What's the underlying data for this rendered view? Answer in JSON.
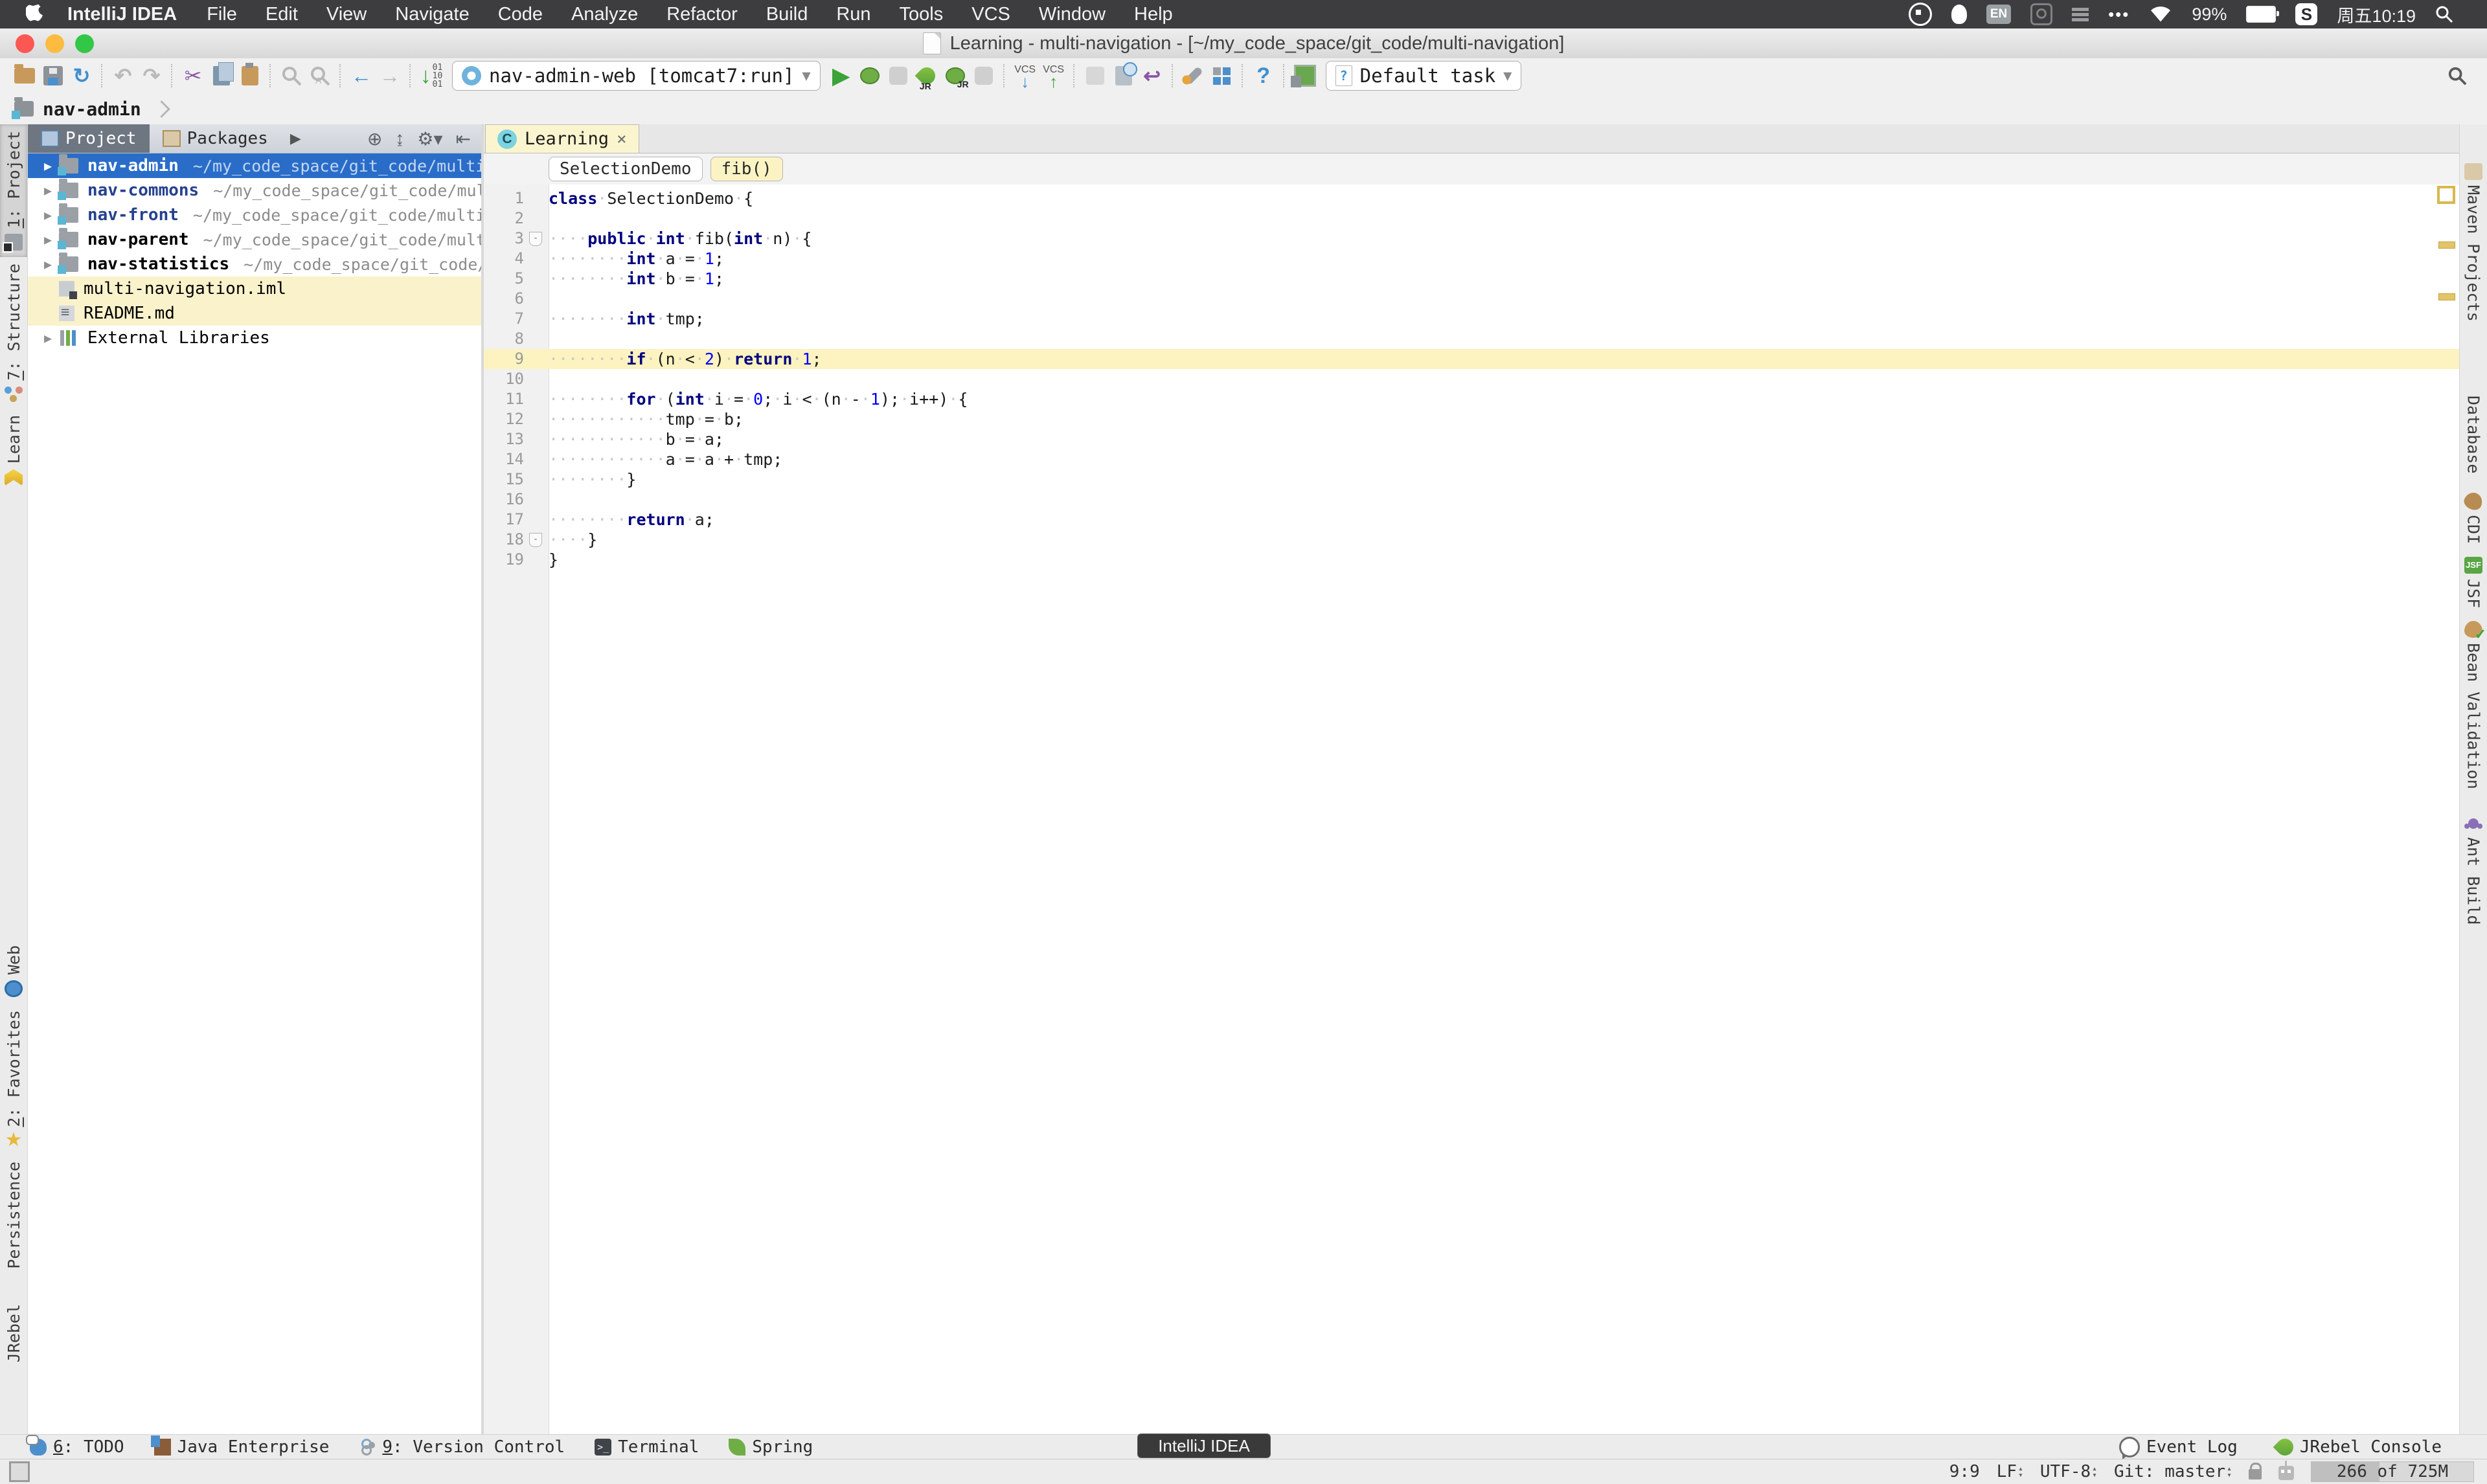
{
  "menubar": {
    "app_name": "IntelliJ IDEA",
    "items": [
      "File",
      "Edit",
      "View",
      "Navigate",
      "Code",
      "Analyze",
      "Refactor",
      "Build",
      "Run",
      "Tools",
      "VCS",
      "Window",
      "Help"
    ],
    "status": {
      "input_badge": "EN",
      "battery_pct": "99%",
      "sogou_badge": "S",
      "clock": "周五10:19",
      "icons": [
        "record-icon",
        "qq-icon",
        "input-en-badge",
        "input-search-icon",
        "bars-icon",
        "more-dots-icon",
        "wifi-icon",
        "battery-icon",
        "sogou-icon",
        "spotlight-search-icon"
      ]
    }
  },
  "titlebar": {
    "title": "Learning - multi-navigation - [~/my_code_space/git_code/multi-navigation]"
  },
  "toolbar": {
    "run_config": "nav-admin-web [tomcat7:run]",
    "task_selector": "Default task",
    "vcs_down_label": "VCS",
    "vcs_up_label": "VCS",
    "hex_bits": "01 10 01",
    "left_icon_groups": [
      [
        "open-folder-icon",
        "save-icon",
        "sync-icon"
      ],
      [
        "undo-icon",
        "redo-icon"
      ],
      [
        "cut-icon",
        "copy-icon",
        "paste-icon"
      ],
      [
        "find-icon",
        "replace-icon"
      ],
      [
        "back-icon",
        "forward-icon"
      ],
      [
        "hex-download-icon"
      ]
    ],
    "run_icons": [
      "run-icon",
      "debug-icon",
      "coverage-icon",
      "jrebel-run-icon",
      "jrebel-debug-icon",
      "profile-icon"
    ],
    "misc_icon_groups": [
      [
        "shelve-icon",
        "history-icon",
        "revert-icon"
      ],
      [
        "settings-wrench-icon",
        "project-structure-icon"
      ],
      [
        "help-icon"
      ],
      [
        "jrebel-save-icon"
      ]
    ],
    "search_icon": "toolbar-search-icon"
  },
  "breadcrumb": {
    "module": "nav-admin"
  },
  "project_panel": {
    "tabs": [
      "Project",
      "Packages"
    ],
    "header_icons": [
      "locate-icon",
      "collapse-all-icon",
      "gear-menu-icon",
      "hide-panel-icon"
    ],
    "tree": [
      {
        "type": "module",
        "name": "nav-admin",
        "path": "~/my_code_space/git_code/multi-n",
        "selected": true,
        "arrow": true
      },
      {
        "type": "module",
        "name": "nav-commons",
        "path": "~/my_code_space/git_code/multi",
        "name_color": "blue",
        "arrow": true
      },
      {
        "type": "module",
        "name": "nav-front",
        "path": "~/my_code_space/git_code/multi-n",
        "name_color": "blue",
        "arrow": true
      },
      {
        "type": "module",
        "name": "nav-parent",
        "path": "~/my_code_space/git_code/multi-",
        "arrow": true
      },
      {
        "type": "module",
        "name": "nav-statistics",
        "path": "~/my_code_space/git_code/mu",
        "arrow": true
      },
      {
        "type": "iml",
        "name": "multi-navigation.iml",
        "highlight": true,
        "plain": true
      },
      {
        "type": "md",
        "name": "README.md",
        "highlight": true,
        "plain": true
      },
      {
        "type": "lib",
        "name": "External Libraries",
        "arrow": true,
        "plain": true
      }
    ]
  },
  "editor": {
    "tab_label": "Learning",
    "tab_close": "×",
    "crumbs": [
      {
        "label": "SelectionDemo",
        "current": false
      },
      {
        "label": "fib()",
        "current": true
      }
    ],
    "lines": [
      {
        "n": 1,
        "tokens": [
          [
            "k",
            "class"
          ],
          [
            "p",
            " SelectionDemo {"
          ]
        ]
      },
      {
        "n": 2,
        "tokens": []
      },
      {
        "n": 3,
        "fold": "-",
        "tokens": [
          [
            "p",
            "    "
          ],
          [
            "k",
            "public"
          ],
          [
            "p",
            " "
          ],
          [
            "k",
            "int"
          ],
          [
            "p",
            " fib("
          ],
          [
            "k",
            "int"
          ],
          [
            "p",
            " n) {"
          ]
        ]
      },
      {
        "n": 4,
        "tokens": [
          [
            "p",
            "        "
          ],
          [
            "k",
            "int"
          ],
          [
            "p",
            " a = "
          ],
          [
            "n2",
            "1"
          ],
          [
            "p",
            ";"
          ]
        ]
      },
      {
        "n": 5,
        "tokens": [
          [
            "p",
            "        "
          ],
          [
            "k",
            "int"
          ],
          [
            "p",
            " b = "
          ],
          [
            "n2",
            "1"
          ],
          [
            "p",
            ";"
          ]
        ]
      },
      {
        "n": 6,
        "tokens": []
      },
      {
        "n": 7,
        "tokens": [
          [
            "p",
            "        "
          ],
          [
            "k",
            "int"
          ],
          [
            "p",
            " tmp;"
          ]
        ]
      },
      {
        "n": 8,
        "tokens": []
      },
      {
        "n": 9,
        "hl": true,
        "tokens": [
          [
            "p",
            "        "
          ],
          [
            "k",
            "if"
          ],
          [
            "p",
            " (n < "
          ],
          [
            "n2",
            "2"
          ],
          [
            "p",
            ") "
          ],
          [
            "k",
            "return"
          ],
          [
            "p",
            " "
          ],
          [
            "n2",
            "1"
          ],
          [
            "p",
            ";"
          ]
        ]
      },
      {
        "n": 10,
        "tokens": []
      },
      {
        "n": 11,
        "tokens": [
          [
            "p",
            "        "
          ],
          [
            "k",
            "for"
          ],
          [
            "p",
            " ("
          ],
          [
            "k",
            "int"
          ],
          [
            "p",
            " i = "
          ],
          [
            "n2",
            "0"
          ],
          [
            "p",
            "; i < (n - "
          ],
          [
            "n2",
            "1"
          ],
          [
            "p",
            "); i++) {"
          ]
        ]
      },
      {
        "n": 12,
        "tokens": [
          [
            "p",
            "            tmp = b;"
          ]
        ]
      },
      {
        "n": 13,
        "tokens": [
          [
            "p",
            "            b = a;"
          ]
        ]
      },
      {
        "n": 14,
        "tokens": [
          [
            "p",
            "            a = a + tmp;"
          ]
        ]
      },
      {
        "n": 15,
        "tokens": [
          [
            "p",
            "        }"
          ]
        ]
      },
      {
        "n": 16,
        "tokens": []
      },
      {
        "n": 17,
        "tokens": [
          [
            "p",
            "        "
          ],
          [
            "k",
            "return"
          ],
          [
            "p",
            " a;"
          ]
        ]
      },
      {
        "n": 18,
        "fold": "-",
        "tokens": [
          [
            "p",
            "    }"
          ]
        ]
      },
      {
        "n": 19,
        "tokens": [
          [
            "p",
            "}"
          ]
        ]
      }
    ]
  },
  "stripes": {
    "left_top": [
      {
        "num": "1",
        "label": "Project",
        "icon": "module-icon",
        "active": true
      },
      {
        "num": "7",
        "label": "Structure",
        "icon": "structure-icon"
      },
      {
        "num": "",
        "label": "Learn",
        "icon": "learn-icon"
      }
    ],
    "left_bottom": [
      {
        "num": "",
        "label": "Web",
        "icon": "web-icon"
      },
      {
        "num": "2",
        "label": "Favorites",
        "icon": "star-icon"
      },
      {
        "num": "",
        "label": "Persistence",
        "icon": "persistence-icon"
      },
      {
        "num": "",
        "label": "JRebel",
        "icon": "jrebel-icon"
      }
    ],
    "right": [
      {
        "label": "Maven Projects",
        "icon": "maven-icon"
      },
      {
        "label": "Database",
        "icon": "database-icon"
      },
      {
        "label": "CDI",
        "icon": "cdi-icon"
      },
      {
        "label": "JSF",
        "icon": "jsf-icon"
      },
      {
        "label": "Bean Validation",
        "icon": "bean-validation-icon"
      },
      {
        "label": "Ant Build",
        "icon": "ant-icon"
      }
    ]
  },
  "bottom_bar": {
    "left": [
      {
        "num": "6",
        "label": "TODO",
        "icon": "todo-icon"
      },
      {
        "num": "",
        "label": "Java Enterprise",
        "icon": "java-ee-icon"
      },
      {
        "num": "9",
        "label": "Version Control",
        "icon": "version-control-icon"
      },
      {
        "num": "",
        "label": "Terminal",
        "icon": "terminal-icon"
      },
      {
        "num": "",
        "label": "Spring",
        "icon": "spring-icon"
      }
    ],
    "right": [
      {
        "label": "Event Log",
        "icon": "event-log-icon"
      },
      {
        "label": "JRebel Console",
        "icon": "jrebel-console-icon"
      }
    ],
    "tooltip": "IntelliJ IDEA"
  },
  "status_bar": {
    "caret_position": "9:9",
    "line_separator": "LF",
    "encoding": "UTF-8",
    "git_branch": "Git: master",
    "memory_text": "266 of 725M",
    "icons": [
      "lock-icon",
      "hector-icon"
    ]
  }
}
